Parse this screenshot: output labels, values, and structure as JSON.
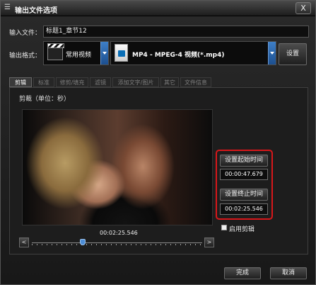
{
  "window": {
    "title": "输出文件选项",
    "close_label": "X"
  },
  "input_file": {
    "label": "输入文件：",
    "value": "标题1_章节12"
  },
  "output_format": {
    "label": "输出格式：",
    "category": "常用视频",
    "format": "MP4 - MPEG-4 视频(*.mp4)",
    "settings_label": "设置"
  },
  "tabs": [
    {
      "label": "剪辑",
      "active": true
    },
    {
      "label": "标准",
      "active": false
    },
    {
      "label": "修剪/填充",
      "active": false
    },
    {
      "label": "滤镜",
      "active": false
    },
    {
      "label": "添加文字/图片",
      "active": false
    },
    {
      "label": "其它",
      "active": false
    },
    {
      "label": "文件信息",
      "active": false
    }
  ],
  "clip": {
    "group_label": "剪裁（单位：秒）",
    "set_start_label": "设置起始时间",
    "start_time": "00:00:47.679",
    "set_end_label": "设置终止时间",
    "end_time": "00:02:25.546",
    "enable_label": "启用剪辑",
    "enable_checked": false,
    "current_time": "00:02:25.546",
    "slider_position_fraction": 0.3
  },
  "footer": {
    "ok_label": "完成",
    "cancel_label": "取消"
  },
  "colors": {
    "accent": "#2f72c0",
    "highlight_box": "#d8171a"
  }
}
